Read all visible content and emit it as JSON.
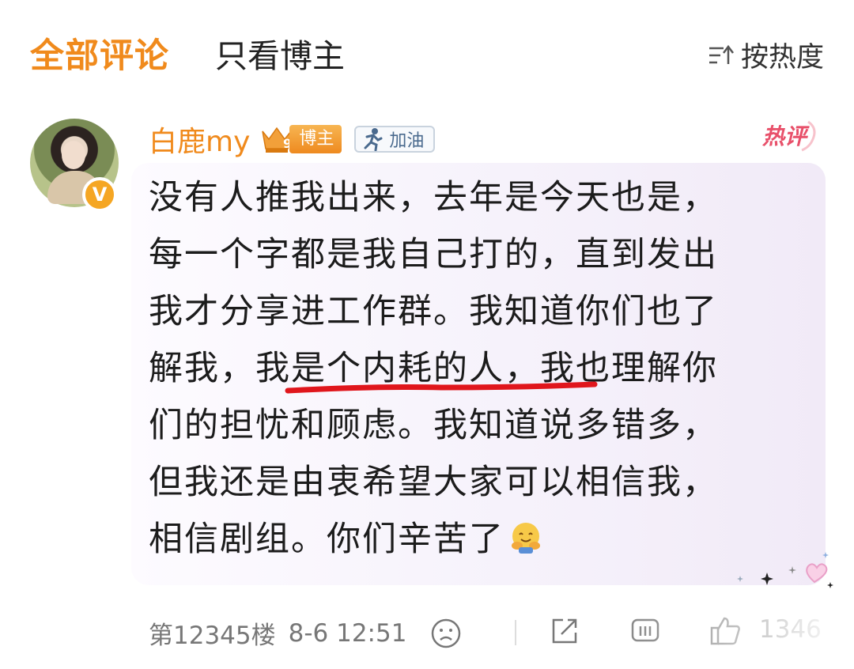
{
  "tabs": {
    "all": "全部评论",
    "author_only": "只看博主"
  },
  "sort": {
    "label": "按热度",
    "icon": "sort-icon"
  },
  "comment": {
    "username": "白鹿my",
    "level_badge": "9",
    "author_tag": "博主",
    "cheer_badge": "加油",
    "hot_label": "热评",
    "verified": "V",
    "lines": [
      "没有人推我出来，去年是今天也是，",
      "每一个字都是我自己打的，直到发出",
      "我才分享进工作群。我知道你们也了",
      "解我，我是个内耗的人，我也理解你",
      "们的担忧和顾虑。我知道说多错多，",
      "但我还是由衷希望大家可以相信我，",
      "相信剧组。你们辛苦了"
    ],
    "emoji": "hug-emoji",
    "highlight": "我是个内耗的人，"
  },
  "footer": {
    "floor": "第12345楼",
    "time": "8-6 12:51",
    "likes": "1346"
  },
  "colors": {
    "accent": "#f08a1c",
    "hot": "#e8506a",
    "underline": "#e0161c"
  }
}
